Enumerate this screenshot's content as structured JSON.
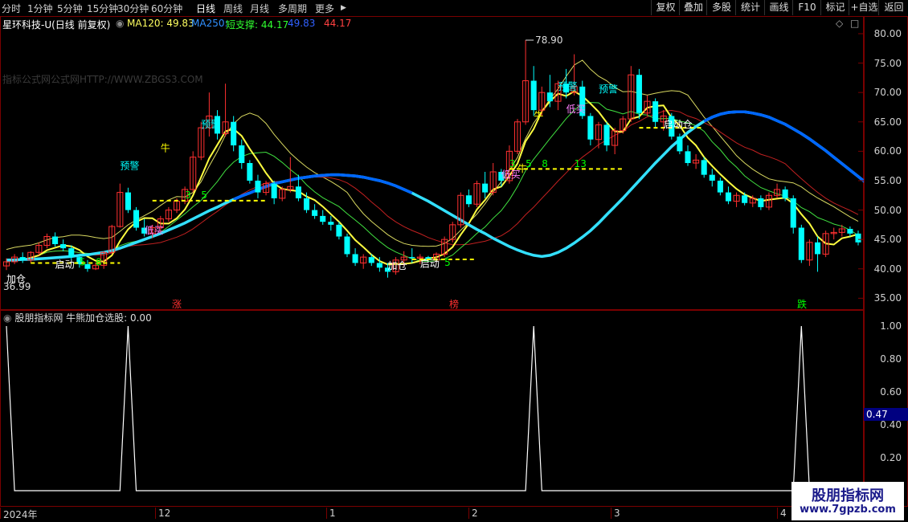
{
  "toolbar": {
    "periods": [
      "分时",
      "1分钟",
      "5分钟",
      "15分钟",
      "30分钟",
      "60分钟",
      "日线",
      "周线",
      "月线",
      "多周期",
      "更多"
    ],
    "active_period": "日线",
    "more_arrow": "▶",
    "right_buttons": [
      "复权",
      "叠加",
      "多股",
      "统计",
      "画线",
      "F10",
      "标记",
      "+自选",
      "返回"
    ]
  },
  "header": {
    "stock_title": "星环科技-U(日线 前复权)",
    "ma120_label": "MA120: 49.83",
    "ma250_label": "MA250:",
    "support_label": "短支撑: 44.17",
    "value_blue": "49.83",
    "value_red": "44.17",
    "icons": [
      "diamond-icon",
      "square-icon"
    ]
  },
  "watermark": "指标公式网公式网HTTP://WWW.ZBGS3.COM",
  "main_chart": {
    "y_axis": [
      "80.00",
      "75.00",
      "70.00",
      "65.00",
      "60.00",
      "55.00",
      "50.00",
      "45.00",
      "40.00",
      "35.00"
    ],
    "high_label": "78.90",
    "low_label": "36.99",
    "annotations": [
      {
        "text": "加仓",
        "color": "#ffffff"
      },
      {
        "text": "启动",
        "color": "#ffffff"
      },
      {
        "text": "5",
        "color": "#00ff00"
      },
      {
        "text": "8",
        "color": "#00ff00"
      },
      {
        "text": "预警",
        "color": "#00ffff"
      },
      {
        "text": "低买",
        "color": "#ff80ff"
      },
      {
        "text": "牛",
        "color": "#ffff00"
      },
      {
        "text": "预警",
        "color": "#00ffff"
      },
      {
        "text": "3",
        "color": "#00ff00"
      },
      {
        "text": "5",
        "color": "#00ff00"
      },
      {
        "text": "加仓",
        "color": "#ffffff"
      },
      {
        "text": "启动",
        "color": "#ffffff"
      },
      {
        "text": "5",
        "color": "#00ff00"
      },
      {
        "text": "低买",
        "color": "#ff80ff"
      },
      {
        "text": "牛",
        "color": "#ffff00"
      },
      {
        "text": "3",
        "color": "#00ff00"
      },
      {
        "text": "5",
        "color": "#00ff00"
      },
      {
        "text": "8",
        "color": "#00ff00"
      },
      {
        "text": "13",
        "color": "#00ff00"
      },
      {
        "text": "预警",
        "color": "#00ffff"
      },
      {
        "text": "低买",
        "color": "#ff80ff"
      },
      {
        "text": "牛",
        "color": "#ffff00"
      },
      {
        "text": "预警",
        "color": "#00ffff"
      },
      {
        "text": "启动仓",
        "color": "#ffffff"
      }
    ],
    "bottom_tags": [
      {
        "text": "涨",
        "color": "#ff3030"
      },
      {
        "text": "榜",
        "color": "#ff3030"
      },
      {
        "text": "跌",
        "color": "#00ff00"
      }
    ],
    "colors": {
      "up": "#ff3030",
      "down": "#00ffff",
      "ma_blue": "#0066ff",
      "ma_cyan": "#33e0ff",
      "yellow": "#ffff00",
      "white": "#ffffff",
      "magenta": "#ff40ff"
    }
  },
  "indicator": {
    "title": "股朋指标网 牛熊加仓选股: 0.00",
    "y_axis": [
      "1.00",
      "0.80",
      "0.60",
      "0.40",
      "0.20"
    ],
    "current_value": "0.47"
  },
  "dates": [
    "2024年",
    "12",
    "1",
    "2",
    "3",
    "4"
  ],
  "logo": {
    "name": "股朋指标网",
    "url": "www.7gpzb.com"
  },
  "chart_data": {
    "type": "candlestick",
    "price_ylim": [
      33,
      83
    ],
    "candles": [
      [
        40.5,
        41.8,
        39.8,
        41.2
      ],
      [
        41.2,
        42.5,
        40.8,
        42.0
      ],
      [
        42.0,
        42.8,
        41.0,
        41.5
      ],
      [
        41.5,
        43.0,
        41.0,
        42.8
      ],
      [
        42.8,
        44.5,
        42.3,
        44.0
      ],
      [
        44.0,
        46.0,
        43.5,
        45.5
      ],
      [
        45.5,
        46.2,
        43.8,
        44.2
      ],
      [
        44.2,
        45.0,
        43.0,
        43.5
      ],
      [
        43.5,
        44.0,
        41.5,
        42.0
      ],
      [
        42.0,
        42.5,
        40.2,
        40.8
      ],
      [
        40.8,
        41.5,
        39.5,
        40.0
      ],
      [
        40.0,
        41.0,
        39.8,
        40.6
      ],
      [
        40.6,
        43.0,
        40.0,
        42.8
      ],
      [
        42.8,
        47.5,
        42.5,
        47.2
      ],
      [
        47.2,
        54.5,
        47.0,
        53.0
      ],
      [
        53.0,
        53.8,
        49.5,
        50.0
      ],
      [
        50.0,
        50.5,
        46.5,
        47.0
      ],
      [
        47.0,
        48.5,
        45.5,
        46.0
      ],
      [
        46.0,
        47.5,
        45.2,
        47.0
      ],
      [
        47.0,
        49.0,
        46.2,
        48.5
      ],
      [
        48.5,
        50.5,
        48.0,
        50.0
      ],
      [
        50.0,
        52.0,
        49.5,
        51.5
      ],
      [
        51.5,
        54.0,
        51.0,
        53.5
      ],
      [
        53.5,
        60.0,
        53.0,
        59.0
      ],
      [
        59.0,
        65.0,
        58.5,
        64.0
      ],
      [
        64.0,
        70.0,
        62.5,
        66.0
      ],
      [
        66.0,
        67.0,
        62.0,
        63.0
      ],
      [
        63.0,
        71.5,
        62.5,
        65.0
      ],
      [
        65.0,
        66.0,
        60.0,
        61.0
      ],
      [
        61.0,
        62.0,
        57.0,
        58.0
      ],
      [
        58.0,
        58.5,
        54.5,
        55.0
      ],
      [
        55.0,
        56.0,
        52.0,
        53.0
      ],
      [
        53.0,
        55.0,
        52.5,
        54.5
      ],
      [
        54.5,
        55.0,
        51.0,
        52.0
      ],
      [
        52.0,
        54.0,
        51.5,
        53.5
      ],
      [
        53.5,
        59.0,
        53.0,
        54.0
      ],
      [
        54.0,
        56.0,
        51.5,
        52.0
      ],
      [
        52.0,
        53.0,
        49.5,
        50.0
      ],
      [
        50.0,
        51.0,
        48.5,
        49.0
      ],
      [
        49.0,
        50.0,
        47.5,
        48.0
      ],
      [
        48.0,
        49.0,
        46.5,
        47.5
      ],
      [
        47.5,
        48.0,
        45.0,
        45.5
      ],
      [
        45.5,
        46.0,
        42.0,
        42.5
      ],
      [
        42.5,
        43.5,
        40.5,
        41.0
      ],
      [
        41.0,
        42.5,
        40.0,
        42.0
      ],
      [
        42.0,
        42.5,
        40.5,
        41.0
      ],
      [
        41.0,
        42.0,
        39.5,
        40.2
      ],
      [
        40.2,
        41.0,
        38.5,
        39.5
      ],
      [
        39.5,
        42.0,
        39.0,
        41.5
      ],
      [
        41.5,
        43.0,
        40.5,
        42.0
      ],
      [
        42.0,
        43.5,
        41.0,
        41.8
      ],
      [
        41.8,
        42.5,
        40.8,
        42.0
      ],
      [
        42.0,
        42.2,
        41.2,
        41.5
      ],
      [
        41.5,
        42.8,
        41.0,
        42.5
      ],
      [
        42.5,
        45.5,
        42.0,
        45.0
      ],
      [
        45.0,
        48.0,
        44.5,
        47.5
      ],
      [
        47.5,
        53.0,
        47.0,
        52.5
      ],
      [
        52.5,
        53.5,
        50.5,
        51.0
      ],
      [
        51.0,
        55.0,
        50.5,
        54.5
      ],
      [
        54.5,
        56.5,
        52.0,
        53.0
      ],
      [
        53.0,
        58.0,
        52.5,
        56.5
      ],
      [
        56.5,
        57.0,
        54.0,
        55.0
      ],
      [
        55.0,
        61.0,
        54.5,
        60.0
      ],
      [
        60.0,
        65.5,
        59.5,
        65.0
      ],
      [
        65.0,
        78.9,
        64.5,
        72.0
      ],
      [
        72.0,
        74.5,
        66.0,
        67.0
      ],
      [
        67.0,
        71.0,
        66.0,
        70.0
      ],
      [
        70.0,
        73.0,
        67.5,
        68.5
      ],
      [
        68.5,
        72.0,
        67.0,
        71.5
      ],
      [
        71.5,
        74.0,
        69.0,
        70.0
      ],
      [
        70.0,
        76.5,
        69.5,
        71.0
      ],
      [
        71.0,
        72.0,
        65.5,
        66.0
      ],
      [
        66.0,
        66.5,
        61.0,
        62.0
      ],
      [
        62.0,
        65.0,
        60.5,
        64.5
      ],
      [
        64.5,
        65.0,
        60.0,
        61.0
      ],
      [
        61.0,
        64.0,
        59.5,
        63.5
      ],
      [
        63.5,
        66.0,
        63.0,
        65.5
      ],
      [
        65.5,
        74.5,
        65.0,
        73.0
      ],
      [
        73.0,
        74.0,
        65.5,
        66.5
      ],
      [
        66.5,
        69.5,
        66.0,
        68.5
      ],
      [
        68.5,
        69.0,
        64.0,
        65.0
      ],
      [
        65.0,
        67.0,
        63.5,
        66.0
      ],
      [
        66.0,
        66.5,
        62.0,
        62.5
      ],
      [
        62.5,
        63.0,
        59.5,
        60.0
      ],
      [
        60.0,
        61.0,
        57.5,
        58.0
      ],
      [
        58.0,
        59.5,
        57.0,
        58.5
      ],
      [
        58.5,
        59.0,
        55.5,
        56.0
      ],
      [
        56.0,
        57.0,
        54.0,
        55.0
      ],
      [
        55.0,
        55.5,
        52.5,
        53.0
      ],
      [
        53.0,
        54.0,
        51.0,
        51.5
      ],
      [
        51.5,
        53.0,
        50.5,
        52.5
      ],
      [
        52.5,
        53.0,
        50.8,
        51.2
      ],
      [
        51.2,
        52.5,
        50.5,
        52.0
      ],
      [
        52.0,
        52.5,
        50.0,
        50.5
      ],
      [
        50.5,
        53.0,
        50.0,
        52.5
      ],
      [
        52.5,
        54.5,
        52.0,
        53.5
      ],
      [
        53.5,
        54.0,
        51.5,
        52.0
      ],
      [
        52.0,
        52.5,
        46.0,
        47.0
      ],
      [
        47.0,
        47.5,
        41.0,
        41.5
      ],
      [
        41.5,
        45.0,
        40.5,
        44.5
      ],
      [
        44.5,
        45.5,
        39.5,
        42.5
      ],
      [
        42.5,
        46.5,
        42.0,
        46.0
      ],
      [
        46.0,
        47.0,
        45.0,
        46.2
      ],
      [
        46.2,
        47.5,
        45.5,
        46.8
      ],
      [
        46.8,
        47.2,
        45.5,
        46.0
      ],
      [
        46.0,
        46.5,
        44.0,
        44.5
      ]
    ],
    "ma_long": [
      41.5,
      41.5,
      41.6,
      41.6,
      41.7,
      41.8,
      41.9,
      42.0,
      42.1,
      42.3,
      42.4,
      42.6,
      42.8,
      43.1,
      43.5,
      44.0,
      44.5,
      45.0,
      45.5,
      46.0,
      46.6,
      47.2,
      47.8,
      48.5,
      49.2,
      49.9,
      50.5,
      51.2,
      51.8,
      52.4,
      52.9,
      53.5,
      54.0,
      54.5,
      54.8,
      55.1,
      55.4,
      55.6,
      55.8,
      55.9,
      56.0,
      56.0,
      55.9,
      55.8,
      55.6,
      55.3,
      55.0,
      54.6,
      54.1,
      53.5,
      52.9,
      52.2,
      51.5,
      50.7,
      49.9,
      49.1,
      48.3,
      47.5,
      46.7,
      46.0,
      45.2,
      44.5,
      43.8,
      43.2,
      42.7,
      42.3,
      42.1,
      42.3,
      42.8,
      43.5,
      44.4,
      45.4,
      46.5,
      47.8,
      49.2,
      50.6,
      52.0,
      53.5,
      55.0,
      56.5,
      58.0,
      59.4,
      60.8,
      62.0,
      63.2,
      64.2,
      65.1,
      65.8,
      66.3,
      66.6,
      66.7,
      66.7,
      66.5,
      66.2,
      65.8,
      65.2,
      64.6,
      63.8,
      63.0,
      62.1,
      61.1,
      60.1,
      59.0,
      57.9,
      56.8,
      55.7,
      54.6,
      53.6,
      52.6,
      51.7,
      50.8,
      50.1
    ]
  }
}
